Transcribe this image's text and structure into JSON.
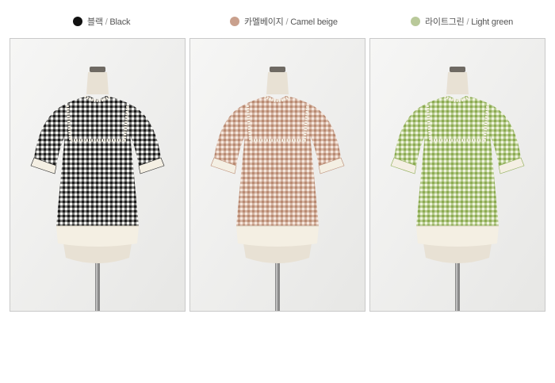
{
  "colors": [
    {
      "name_ko": "블랙",
      "name_en": "Black",
      "swatch": "#111111",
      "main": "#1c1c1c",
      "light": "#f3f3f0"
    },
    {
      "name_ko": "카멜베이지",
      "name_en": "Camel beige",
      "swatch": "#c9a08d",
      "main": "#b98a72",
      "light": "#f5e6dc"
    },
    {
      "name_ko": "라이트그린",
      "name_en": "Light green",
      "swatch": "#b9c99a",
      "main": "#8cab52",
      "light": "#eef3dc"
    }
  ],
  "separator": " / ",
  "trim_color": "#f4efe3",
  "mannequin_color": "#e8e1d4",
  "pole_color": "#8b8b8b"
}
